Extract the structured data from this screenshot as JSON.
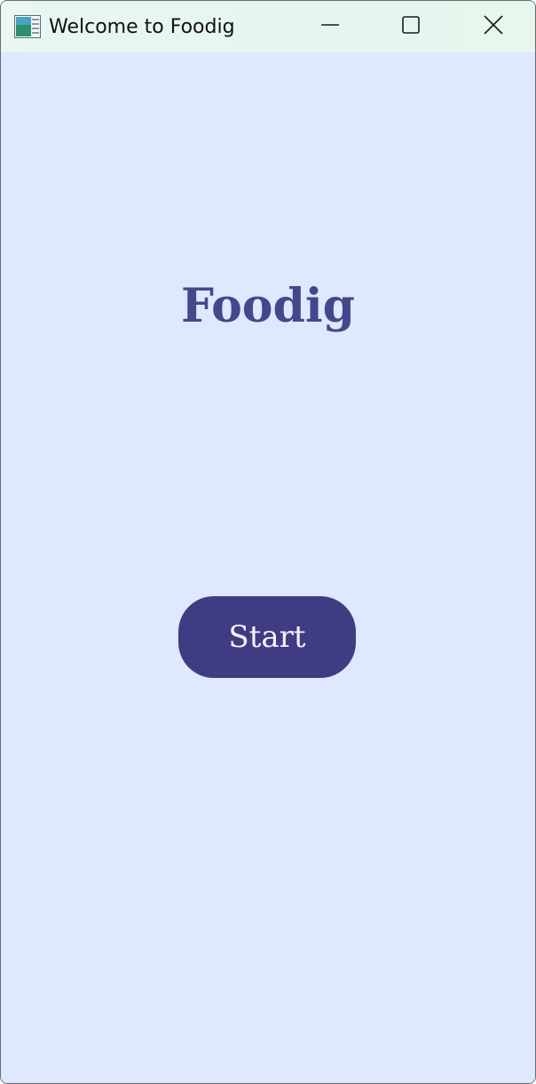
{
  "window": {
    "title": "Welcome to Foodig",
    "app_icon": "window-app-icon",
    "controls": {
      "minimize_icon": "minimize-icon",
      "maximize_icon": "maximize-icon",
      "close_icon": "close-icon"
    }
  },
  "main": {
    "title": "Foodig",
    "start_label": "Start"
  },
  "colors": {
    "background": "#dee8ff",
    "title": "#46468a",
    "button": "#403c84",
    "button_text": "#f2f2fb"
  }
}
